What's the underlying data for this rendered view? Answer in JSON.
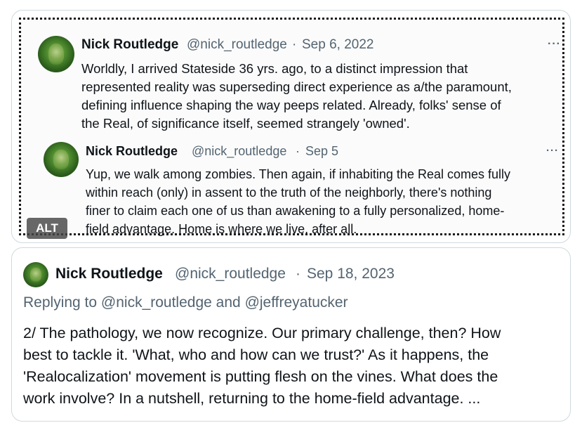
{
  "embedded_image": {
    "alt_label": "ALT",
    "tweet_1": {
      "name": "Nick Routledge",
      "handle": "@nick_routledge",
      "dot": "·",
      "date": "Sep 6, 2022",
      "more": "···",
      "lines": [
        "Worldly, I arrived Stateside 36 yrs. ago, to a distinct impression that",
        "represented reality was superseding direct experience as a/the paramount,",
        "defining influence shaping the way peeps related. Already, folks' sense of",
        "the Real, of significance itself, seemed strangely 'owned'."
      ]
    },
    "tweet_2": {
      "name": "Nick Routledge",
      "handle": "@nick_routledge",
      "dot": "·",
      "date": "Sep 5",
      "more": "···",
      "lines": [
        "Yup, we walk among zombies. Then again, if inhabiting the Real comes fully",
        "within reach (only) in assent to the truth of the neighborly, there's nothing",
        "finer to claim each one of us than awakening to a fully personalized, home-",
        "field advantage. Home is where we live, after all."
      ]
    }
  },
  "reply_tweet": {
    "name": "Nick Routledge",
    "handle": "@nick_routledge",
    "dot": "·",
    "date": "Sep 18, 2023",
    "replying_prefix": "Replying to",
    "replying_user_1": "@nick_routledge",
    "replying_and": "and",
    "replying_user_2": "@jeffreyatucker",
    "lines": [
      "2/ The pathology, we now recognize. Our primary challenge, then? How",
      "best to tackle it. 'What, who and how can we trust?' As it happens, the",
      "'Realocalization' movement is putting flesh on the vines. What does the",
      "work involve? In a nutshell, returning to the home-field advantage. ..."
    ]
  }
}
